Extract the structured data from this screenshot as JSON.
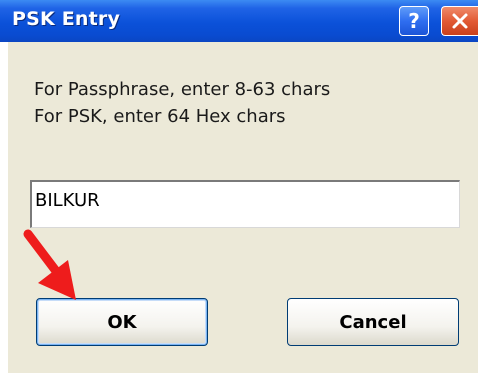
{
  "dialog": {
    "title": "PSK Entry",
    "help_label": "?",
    "close_label": "✕",
    "instructions": {
      "line1": "For Passphrase, enter 8-63 chars",
      "line2": "For PSK, enter 64 Hex chars"
    },
    "psk_input_value": "BILKUR",
    "ok_label": "OK",
    "cancel_label": "Cancel"
  },
  "icons": {
    "help": "help-icon",
    "close": "close-icon",
    "annotation": "red-arrow-icon"
  },
  "colors": {
    "titlebar": "#0b51d9",
    "close_button": "#e25a35",
    "dialog_background": "#ece9d8",
    "annotation_arrow": "#ee1c1c"
  }
}
